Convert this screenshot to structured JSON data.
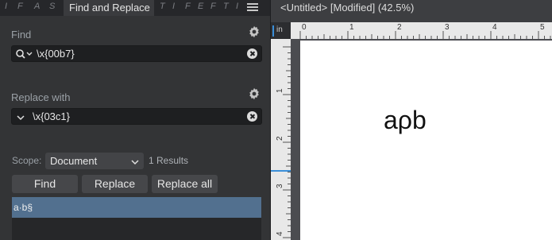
{
  "panel": {
    "collapsed_tabs": [
      "I",
      "F",
      "A",
      "S",
      "T",
      "I",
      "F",
      "E",
      "F",
      "T",
      "I"
    ],
    "active_tab": "Find and Replace",
    "find": {
      "label": "Find",
      "value": "\\x{00b7}"
    },
    "replace": {
      "label": "Replace with",
      "value": "\\x{03c1}"
    },
    "scope": {
      "label": "Scope:",
      "selected": "Document",
      "results": "1 Results"
    },
    "buttons": {
      "find": "Find",
      "replace": "Replace",
      "replace_all": "Replace all"
    },
    "results": [
      "a·b§"
    ]
  },
  "document": {
    "title": "<Untitled> [Modified] (42.5%)",
    "ruler_unit": "in",
    "top_ruler_labels": [
      "0",
      "1",
      "2",
      "3",
      "4",
      "5"
    ],
    "left_ruler_labels": [
      "1",
      "2",
      "3",
      "4"
    ],
    "page_text": "aρb"
  },
  "colors": {
    "panel_bg": "#333436",
    "field_bg": "#1e1f21",
    "selected_row": "#52708f",
    "accent_blue": "#3b8fd9",
    "page": "#ffffff"
  }
}
